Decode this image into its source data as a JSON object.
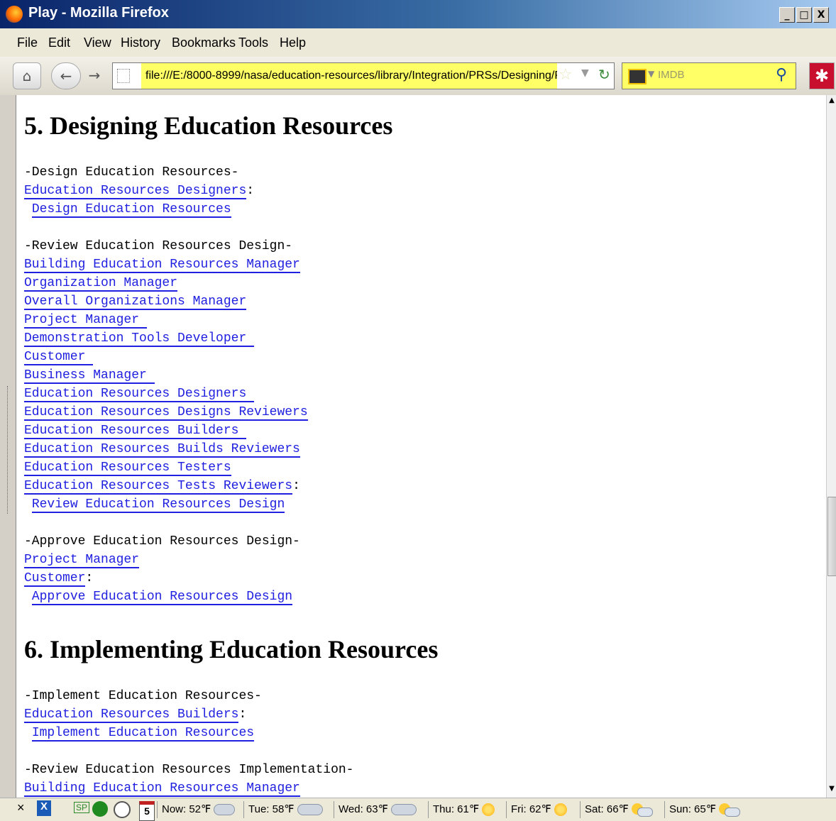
{
  "window": {
    "title": "Play - Mozilla Firefox",
    "controls": [
      "_",
      "□",
      "X"
    ]
  },
  "menu": [
    "File",
    "Edit",
    "View",
    "History",
    "Bookmarks",
    "Tools",
    "Help"
  ],
  "nav": {
    "home_icon": "home-icon",
    "back_icon": "back-arrow-icon",
    "forward_icon": "forward-arrow-icon",
    "url": "file:///E:/8000-8999/nasa/education-resources/library/Integration/PRSs/Designing/Pl",
    "search_placeholder": "IMDB"
  },
  "content": {
    "sections": [
      {
        "heading": "5. Designing Education Resources",
        "groups": [
          {
            "title": "-Design Education Resources-",
            "roles": [
              "Education Resources Designers"
            ],
            "action": "Design Education Resources"
          },
          {
            "title": "-Review Education Resources Design-",
            "roles": [
              "Building Education Resources Manager",
              "Organization Manager",
              "Overall Organizations Manager",
              "Project Manager ",
              "Demonstration Tools Developer ",
              "Customer ",
              "Business Manager ",
              "Education Resources Designers ",
              "Education Resources Designs Reviewers",
              "Education Resources Builders ",
              "Education Resources Builds Reviewers",
              "Education Resources Testers",
              "Education Resources Tests Reviewers"
            ],
            "action": "Review Education Resources Design"
          },
          {
            "title": "-Approve Education Resources Design-",
            "roles": [
              "Project Manager",
              "Customer"
            ],
            "action": "Approve Education Resources Design"
          }
        ]
      },
      {
        "heading": "6. Implementing Education Resources",
        "groups": [
          {
            "title": "-Implement Education Resources-",
            "roles": [
              "Education Resources Builders"
            ],
            "action": "Implement Education Resources"
          },
          {
            "title": "-Review Education Resources Implementation-",
            "roles": [
              "Building Education Resources Manager"
            ]
          }
        ]
      }
    ]
  },
  "status": {
    "close": "×",
    "sp": "SP",
    "calendar_day": "5",
    "forecast": [
      {
        "label": "Now: 52℉",
        "icon": "cloud"
      },
      {
        "label": "Tue: 58℉",
        "icon": "rain-cloud"
      },
      {
        "label": "Wed: 63℉",
        "icon": "rain-cloud"
      },
      {
        "label": "Thu: 61℉",
        "icon": "sun"
      },
      {
        "label": "Fri: 62℉",
        "icon": "sun"
      },
      {
        "label": "Sat: 66℉",
        "icon": "partly-cloudy"
      },
      {
        "label": "Sun: 65℉",
        "icon": "partly-cloudy"
      }
    ]
  }
}
